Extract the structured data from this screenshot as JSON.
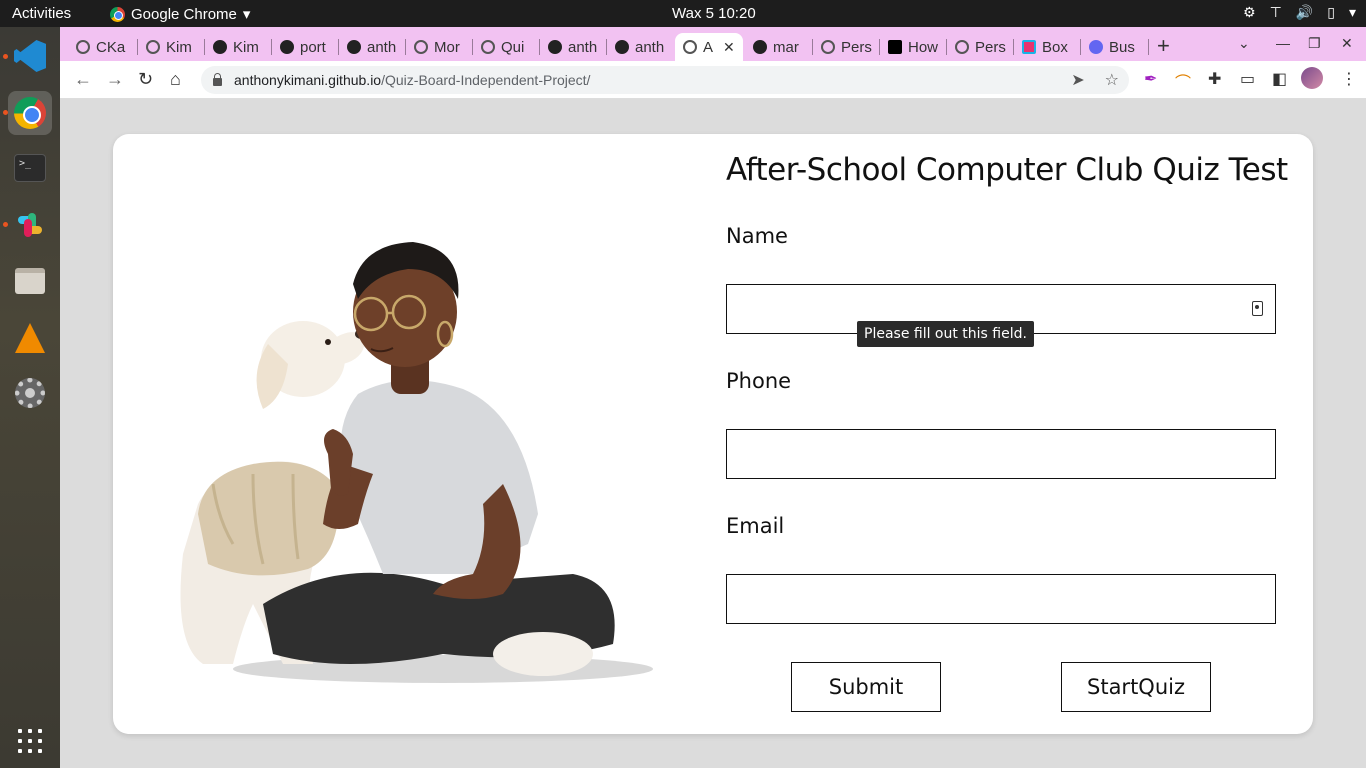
{
  "system": {
    "activities": "Activities",
    "app_name": "Google Chrome",
    "clock": "Wax 5  10:20",
    "tray_icons": [
      "network-icon",
      "volume-icon",
      "battery-icon",
      "power-icon"
    ]
  },
  "dock": {
    "items": [
      "vscode-icon",
      "chrome-icon",
      "terminal-icon",
      "slack-icon",
      "files-icon",
      "vlc-icon",
      "settings-icon"
    ]
  },
  "browser": {
    "tabs": [
      {
        "title": "CKa",
        "icon": "globe"
      },
      {
        "title": "Kim",
        "icon": "globe"
      },
      {
        "title": "Kim",
        "icon": "github"
      },
      {
        "title": "port",
        "icon": "github"
      },
      {
        "title": "anth",
        "icon": "github"
      },
      {
        "title": "Mor",
        "icon": "globe"
      },
      {
        "title": "Qui",
        "icon": "globe"
      },
      {
        "title": "anth",
        "icon": "github"
      },
      {
        "title": "anth",
        "icon": "github"
      },
      {
        "title": "A",
        "icon": "globe",
        "active": true
      },
      {
        "title": "mar",
        "icon": "github"
      },
      {
        "title": "Pers",
        "icon": "globe"
      },
      {
        "title": "How",
        "icon": "dev"
      },
      {
        "title": "Pers",
        "icon": "globe"
      },
      {
        "title": "Box",
        "icon": "box"
      },
      {
        "title": "Bus",
        "icon": "bus"
      }
    ],
    "url_host": "anthonykimani.github.io",
    "url_path": "/Quiz-Board-Independent-Project/"
  },
  "page": {
    "title": "After-School Computer Club Quiz Test",
    "name_label": "Name",
    "phone_label": "Phone",
    "email_label": "Email",
    "name_value": "",
    "phone_value": "",
    "email_value": "",
    "validation_tooltip": "Please fill out this field.",
    "submit_label": "Submit",
    "start_label": "StartQuiz"
  }
}
